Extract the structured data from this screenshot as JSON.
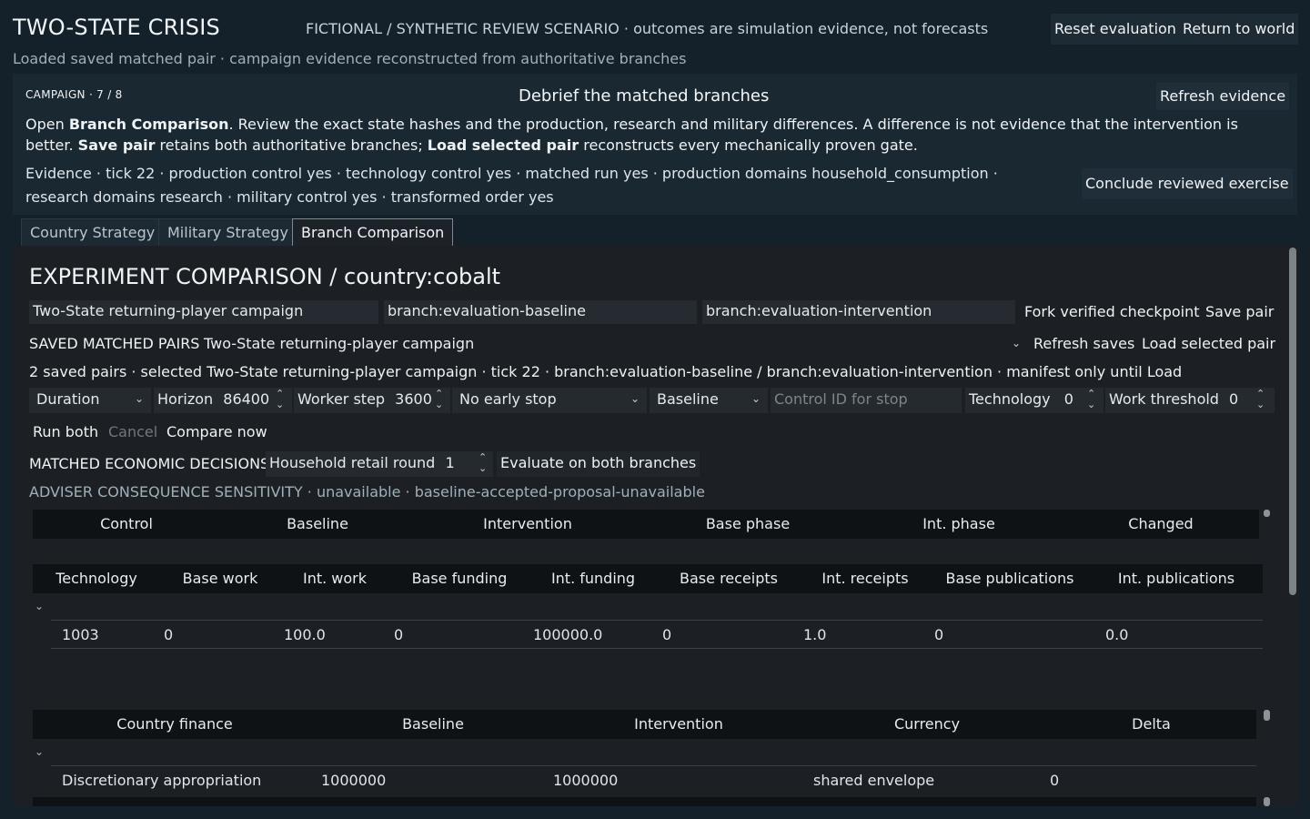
{
  "app": {
    "title": "TWO-STATE CRISIS",
    "disclaimer": "FICTIONAL / SYNTHETIC REVIEW SCENARIO · outcomes are simulation evidence, not forecasts",
    "reset_label": "Reset evaluation",
    "return_label": "Return to world",
    "subtitle": "Loaded saved matched pair · campaign evidence reconstructed from authoritative branches"
  },
  "campaign": {
    "step_label": "CAMPAIGN · 7 / 8",
    "heading": "Debrief the matched branches",
    "refresh_label": "Refresh evidence",
    "text_1": "Open ",
    "text_bold_1": "Branch Comparison",
    "text_2": ". Review the exact state hashes and the production, research and military differences. A difference is not evidence that the intervention is better. ",
    "text_bold_2": "Save pair",
    "text_3": " retains both authoritative branches; ",
    "text_bold_3": "Load selected pair",
    "text_4": " reconstructs every mechanically proven gate.",
    "evidence": "Evidence · tick 22 · production control yes · technology control yes · matched run yes · production domains household_consumption · research domains research · military control yes · transformed order yes",
    "conclude_label": "Conclude reviewed exercise"
  },
  "tabs": [
    {
      "label": "Country Strategy"
    },
    {
      "label": "Military Strategy"
    },
    {
      "label": "Branch Comparison"
    }
  ],
  "experiment": {
    "title": "EXPERIMENT COMPARISON  /  country:cobalt",
    "campaign_field": "Two-State returning-player campaign",
    "baseline_field": "branch:evaluation-baseline",
    "intervention_field": "branch:evaluation-intervention",
    "fork_label": "Fork verified checkpoint",
    "save_pair_label": "Save pair",
    "saved_pairs_label": "SAVED MATCHED PAIRS",
    "saved_pairs_selected": "Two-State returning-player campaign",
    "refresh_saves_label": "Refresh saves",
    "load_pair_label": "Load selected pair",
    "status_line": "2 saved pairs · selected Two-State returning-player campaign · tick 22 · branch:evaluation-baseline / branch:evaluation-intervention · manifest only until Load"
  },
  "controls": {
    "duration": "Duration",
    "horizon_label": "Horizon",
    "horizon_value": "86400",
    "worker_step_label": "Worker step",
    "worker_step_value": "3600",
    "early_stop": "No early stop",
    "branch_select": "Baseline",
    "control_id_placeholder": "Control ID for stop",
    "technology_label": "Technology",
    "technology_value": "0",
    "work_threshold_label": "Work threshold",
    "work_threshold_value": "0",
    "run_both_label": "Run both",
    "cancel_label": "Cancel",
    "compare_now_label": "Compare now"
  },
  "economic": {
    "label": "MATCHED ECONOMIC DECISIONS",
    "round_label": "Household retail round",
    "round_value": "1",
    "evaluate_label": "Evaluate on both branches"
  },
  "sensitivity": "ADVISER CONSEQUENCE SENSITIVITY · unavailable · baseline-accepted-proposal-unavailable",
  "control_table": {
    "headers": [
      "Control",
      "Baseline",
      "Intervention",
      "Base phase",
      "Int. phase",
      "Changed"
    ]
  },
  "tech_table": {
    "headers": [
      "Technology",
      "Base work",
      "Int. work",
      "Base funding",
      "Int. funding",
      "Base receipts",
      "Int. receipts",
      "Base publications",
      "Int. publications"
    ],
    "rows": [
      [
        "1003",
        "0",
        "100.0",
        "0",
        "100000.0",
        "0",
        "1.0",
        "0",
        "0.0"
      ]
    ]
  },
  "finance_table": {
    "headers": [
      "Country finance",
      "Baseline",
      "Intervention",
      "Currency",
      "Delta"
    ],
    "rows": [
      [
        "Discretionary appropriation",
        "1000000",
        "1000000",
        "shared envelope",
        "0"
      ]
    ]
  }
}
